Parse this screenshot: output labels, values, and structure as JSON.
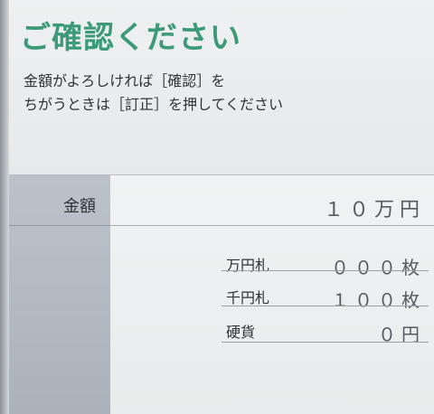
{
  "title": "ご確認ください",
  "instructions": [
    "金額がよろしければ［確認］を",
    "ちがうときは［訂正］を押してください"
  ],
  "amount": {
    "label": "金額",
    "value": "１０万円"
  },
  "breakdown": [
    {
      "label": "万円札",
      "value": "０００枚"
    },
    {
      "label": "千円札",
      "value": "１００枚"
    },
    {
      "label": "硬貨",
      "value": "０円"
    }
  ],
  "colors": {
    "title": "#3c9a78",
    "left_panel": "#b4bbc4",
    "background": "#e7eaeb"
  }
}
